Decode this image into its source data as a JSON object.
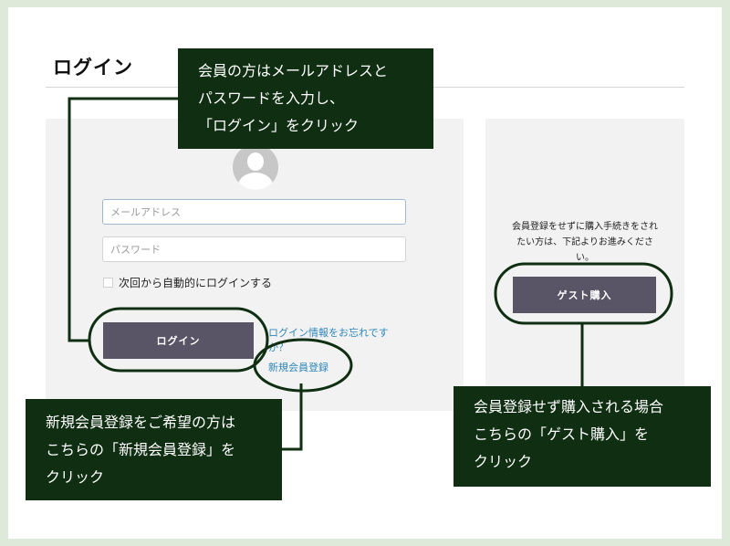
{
  "page": {
    "title": "ログイン"
  },
  "login_form": {
    "email_placeholder": "メールアドレス",
    "password_placeholder": "パスワード",
    "remember_label": "次回から自動的にログインする",
    "login_button": "ログイン",
    "forgot_link": "ログイン情報をお忘れですか？",
    "register_link": "新規会員登録"
  },
  "guest": {
    "description": "会員登録をせずに購入手続きをされたい方は、下記よりお進みください。",
    "button": "ゲスト購入"
  },
  "callouts": {
    "login": [
      "会員の方はメールアドレスと",
      "パスワードを入力し、",
      "「ログイン」をクリック"
    ],
    "register": [
      "新規会員登録をご希望の方は",
      "こちらの「新規会員登録」を",
      "クリック"
    ],
    "guest": [
      "会員登録せず購入される場合",
      "こちらの「ゲスト購入」を",
      "クリック"
    ]
  },
  "colors": {
    "callout_bg": "#0f2e12",
    "button_bg": "#5a5566",
    "link": "#2f86b9",
    "background": "#dfe9d9"
  },
  "icons": {
    "avatar": "user-avatar-icon"
  }
}
